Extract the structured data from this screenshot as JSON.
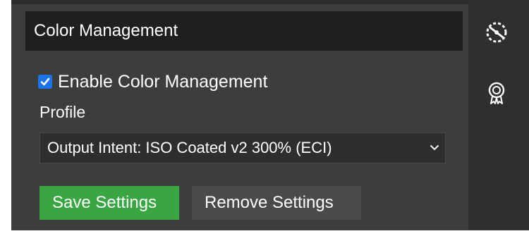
{
  "panel": {
    "title": "Color Management",
    "enable_checkbox": {
      "label": "Enable Color Management",
      "checked": true,
      "accent": "#1a73e8"
    },
    "profile": {
      "label": "Profile",
      "selected": "Output Intent: ISO Coated v2 300% (ECI)"
    },
    "buttons": {
      "save_label": "Save Settings",
      "remove_label": "Remove Settings",
      "save_color": "#3aa543"
    }
  },
  "sidebar": {
    "icons": [
      "color-management-icon",
      "certificate-badge-icon"
    ]
  }
}
